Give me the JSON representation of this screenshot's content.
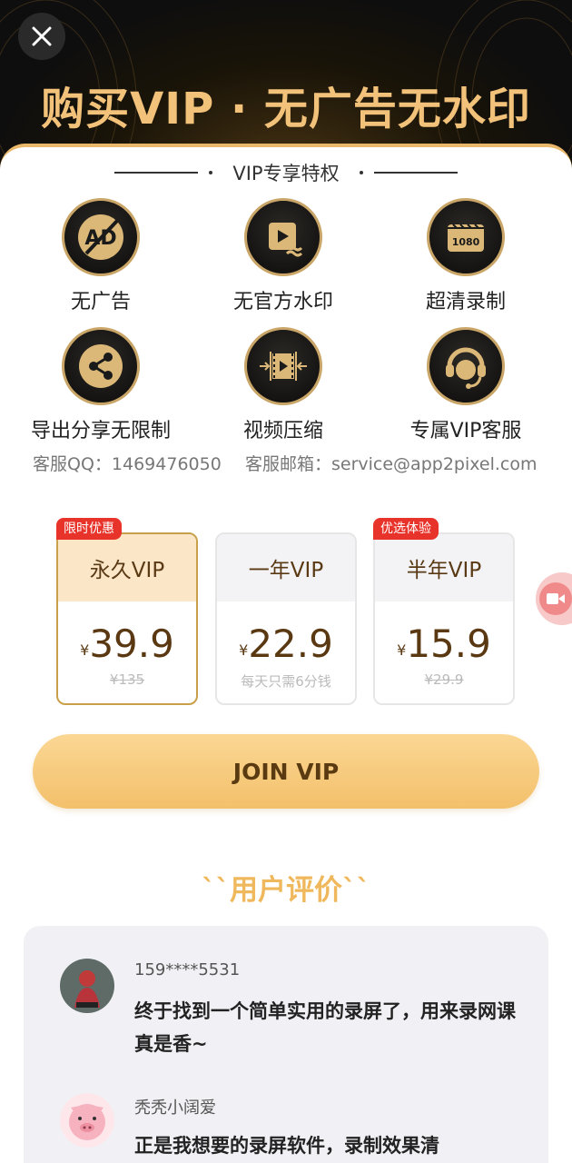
{
  "hero": {
    "title": "购买VIP · 无广告无水印"
  },
  "section": {
    "title": "VIP专享特权"
  },
  "features": [
    {
      "label": "无广告",
      "icon": "no-ad-icon"
    },
    {
      "label": "无官方水印",
      "icon": "video-watermark-icon"
    },
    {
      "label": "超清录制",
      "icon": "1080-film-icon"
    },
    {
      "label": "导出分享无限制",
      "icon": "share-icon"
    },
    {
      "label": "视频压缩",
      "icon": "video-compress-icon"
    },
    {
      "label": "专属VIP客服",
      "icon": "customer-service-icon"
    }
  ],
  "feature_badge": "1080",
  "contact": {
    "qq": "客服QQ：1469476050",
    "email": "客服邮箱：service@app2pixel.com"
  },
  "plans": [
    {
      "title": "永久VIP",
      "currency": "¥",
      "price": "39.9",
      "sub": "¥135",
      "tag": "限时优惠",
      "selected": true
    },
    {
      "title": "一年VIP",
      "currency": "¥",
      "price": "22.9",
      "sub": "每天只需6分钱",
      "tag": "",
      "selected": false
    },
    {
      "title": "半年VIP",
      "currency": "¥",
      "price": "15.9",
      "sub": "¥29.9",
      "tag": "优选体验",
      "selected": false
    }
  ],
  "join_button": "JOIN VIP",
  "reviews": {
    "title": "``用户评价``",
    "items": [
      {
        "name": "159****5531",
        "text": "终于找到一个简单实用的录屏了，用来录网课真是香~"
      },
      {
        "name": "秃秃小阔爱",
        "text": "正是我想要的录屏软件，录制效果清"
      }
    ]
  },
  "colors": {
    "gold": "#f3c27a",
    "brown": "#5a3a14",
    "red_tag": "#e8332a",
    "button": "#f3c06b"
  }
}
